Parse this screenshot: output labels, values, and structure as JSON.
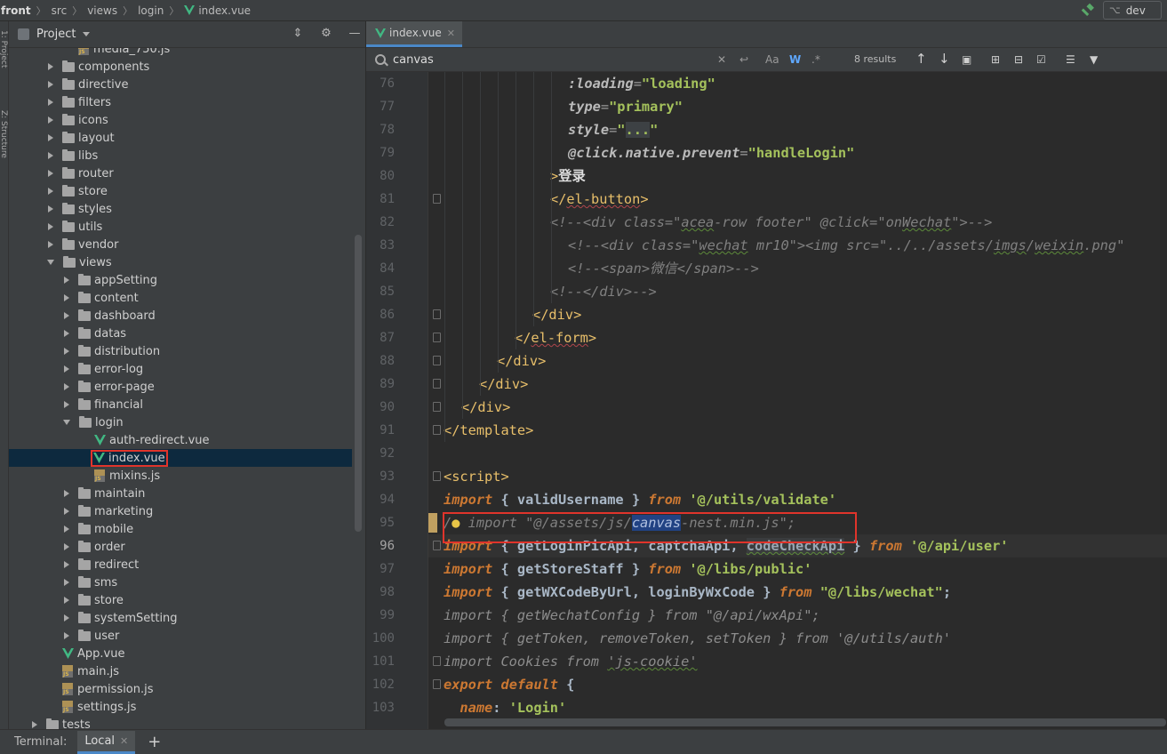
{
  "breadcrumb": [
    "front",
    "src",
    "views",
    "login",
    "index.vue"
  ],
  "branch": "dev",
  "project_panel": {
    "title": "Project",
    "tree": [
      {
        "label": "media_750.js",
        "type": "js",
        "depth": 3,
        "state": "none"
      },
      {
        "label": "components",
        "type": "folder",
        "depth": 2,
        "state": "collapsed"
      },
      {
        "label": "directive",
        "type": "folder",
        "depth": 2,
        "state": "collapsed"
      },
      {
        "label": "filters",
        "type": "folder",
        "depth": 2,
        "state": "collapsed"
      },
      {
        "label": "icons",
        "type": "folder",
        "depth": 2,
        "state": "collapsed"
      },
      {
        "label": "layout",
        "type": "folder",
        "depth": 2,
        "state": "collapsed"
      },
      {
        "label": "libs",
        "type": "folder",
        "depth": 2,
        "state": "collapsed"
      },
      {
        "label": "router",
        "type": "folder",
        "depth": 2,
        "state": "collapsed"
      },
      {
        "label": "store",
        "type": "folder",
        "depth": 2,
        "state": "collapsed"
      },
      {
        "label": "styles",
        "type": "folder",
        "depth": 2,
        "state": "collapsed"
      },
      {
        "label": "utils",
        "type": "folder",
        "depth": 2,
        "state": "collapsed"
      },
      {
        "label": "vendor",
        "type": "folder",
        "depth": 2,
        "state": "collapsed"
      },
      {
        "label": "views",
        "type": "folder",
        "depth": 2,
        "state": "expanded"
      },
      {
        "label": "appSetting",
        "type": "folder",
        "depth": 3,
        "state": "collapsed"
      },
      {
        "label": "content",
        "type": "folder",
        "depth": 3,
        "state": "collapsed"
      },
      {
        "label": "dashboard",
        "type": "folder",
        "depth": 3,
        "state": "collapsed"
      },
      {
        "label": "datas",
        "type": "folder",
        "depth": 3,
        "state": "collapsed"
      },
      {
        "label": "distribution",
        "type": "folder",
        "depth": 3,
        "state": "collapsed"
      },
      {
        "label": "error-log",
        "type": "folder",
        "depth": 3,
        "state": "collapsed"
      },
      {
        "label": "error-page",
        "type": "folder",
        "depth": 3,
        "state": "collapsed"
      },
      {
        "label": "financial",
        "type": "folder",
        "depth": 3,
        "state": "collapsed"
      },
      {
        "label": "login",
        "type": "folder",
        "depth": 3,
        "state": "expanded"
      },
      {
        "label": "auth-redirect.vue",
        "type": "vue",
        "depth": 4,
        "state": "none"
      },
      {
        "label": "index.vue",
        "type": "vue",
        "depth": 4,
        "state": "none",
        "selected": true
      },
      {
        "label": "mixins.js",
        "type": "js",
        "depth": 4,
        "state": "none"
      },
      {
        "label": "maintain",
        "type": "folder",
        "depth": 3,
        "state": "collapsed"
      },
      {
        "label": "marketing",
        "type": "folder",
        "depth": 3,
        "state": "collapsed"
      },
      {
        "label": "mobile",
        "type": "folder",
        "depth": 3,
        "state": "collapsed"
      },
      {
        "label": "order",
        "type": "folder",
        "depth": 3,
        "state": "collapsed"
      },
      {
        "label": "redirect",
        "type": "folder",
        "depth": 3,
        "state": "collapsed"
      },
      {
        "label": "sms",
        "type": "folder",
        "depth": 3,
        "state": "collapsed"
      },
      {
        "label": "store",
        "type": "folder",
        "depth": 3,
        "state": "collapsed"
      },
      {
        "label": "systemSetting",
        "type": "folder",
        "depth": 3,
        "state": "collapsed"
      },
      {
        "label": "user",
        "type": "folder",
        "depth": 3,
        "state": "collapsed"
      },
      {
        "label": "App.vue",
        "type": "vue",
        "depth": 2,
        "state": "none"
      },
      {
        "label": "main.js",
        "type": "js",
        "depth": 2,
        "state": "none"
      },
      {
        "label": "permission.js",
        "type": "js",
        "depth": 2,
        "state": "none"
      },
      {
        "label": "settings.js",
        "type": "js",
        "depth": 2,
        "state": "none"
      },
      {
        "label": "tests",
        "type": "folder",
        "depth": 1,
        "state": "collapsed"
      }
    ]
  },
  "editor": {
    "tab": "index.vue",
    "search": {
      "value": "canvas",
      "results": "8 results",
      "case_label": "Aa",
      "word_label": "W",
      "regex_label": ".*"
    },
    "current_line": 96,
    "lines": [
      {
        "n": 76,
        "fold": false
      },
      {
        "n": 77,
        "fold": false
      },
      {
        "n": 78,
        "fold": false
      },
      {
        "n": 79,
        "fold": false
      },
      {
        "n": 80,
        "fold": false
      },
      {
        "n": 81,
        "fold": true
      },
      {
        "n": 82,
        "fold": false
      },
      {
        "n": 83,
        "fold": false
      },
      {
        "n": 84,
        "fold": false
      },
      {
        "n": 85,
        "fold": false
      },
      {
        "n": 86,
        "fold": true
      },
      {
        "n": 87,
        "fold": true
      },
      {
        "n": 88,
        "fold": true
      },
      {
        "n": 89,
        "fold": true
      },
      {
        "n": 90,
        "fold": true
      },
      {
        "n": 91,
        "fold": true
      },
      {
        "n": 92,
        "fold": false
      },
      {
        "n": 93,
        "fold": true
      },
      {
        "n": 94,
        "fold": false
      },
      {
        "n": 95,
        "fold": false
      },
      {
        "n": 96,
        "fold": true
      },
      {
        "n": 97,
        "fold": false
      },
      {
        "n": 98,
        "fold": false
      },
      {
        "n": 99,
        "fold": false
      },
      {
        "n": 100,
        "fold": false
      },
      {
        "n": 101,
        "fold": true
      },
      {
        "n": 102,
        "fold": true
      },
      {
        "n": 103,
        "fold": false
      }
    ],
    "code": {
      "l76a": ":loading",
      "l76b": "=",
      "l76c": "\"loading\"",
      "l77a": "type",
      "l77b": "=",
      "l77c": "\"primary\"",
      "l78a": "style",
      "l78b": "=",
      "l78c": "\"",
      "l78d": "...",
      "l78e": "\"",
      "l79a": "@click.native.prevent",
      "l79b": "=",
      "l79c": "\"handleLogin\"",
      "l80a": ">",
      "l80b": "登录",
      "l81a": "</",
      "l81b": "el-button",
      "l81c": ">",
      "l82a": "<!--<div class=\"",
      "l82b": "acea",
      "l82c": "-row footer\" @click=\"on",
      "l82d": "Wechat",
      "l82e": "\">-->",
      "l83a": "<!--<div class=\"",
      "l83b": "wechat",
      "l83c": " mr10\"><img src=\"../../assets/",
      "l83d": "imgs",
      "l83e": "/",
      "l83f": "weixin",
      "l83g": ".png\"",
      "l84": "<!--<span>微信</span>-->",
      "l85": "<!--</div>-->",
      "l86a": "</",
      "l86b": "div",
      "l86c": ">",
      "l87a": "</",
      "l87b": "el-form",
      "l87c": ">",
      "l88a": "</",
      "l88b": "div",
      "l88c": ">",
      "l89a": "</",
      "l89b": "div",
      "l89c": ">",
      "l90a": "</",
      "l90b": "div",
      "l90c": ">",
      "l91a": "</",
      "l91b": "template",
      "l91c": ">",
      "l93a": "<",
      "l93b": "script",
      "l93c": ">",
      "l94a": "import",
      "l94b": " { ",
      "l94c": "validUsername",
      "l94d": " } ",
      "l94e": "from",
      "l94f": " '@/utils/validate'",
      "l95a": "/",
      "l95b": " import \"@/assets/js/",
      "l95c": "canvas",
      "l95d": "-nest.min.js\";",
      "l96a": "import",
      "l96b": " { ",
      "l96c": "getLoginPicApi",
      "l96d": ", ",
      "l96e": "captchaApi",
      "l96f": ", ",
      "l96g": "codeCheckApi",
      "l96h": " } ",
      "l96i": "from",
      "l96j": " '@/api/user'",
      "l97a": "import",
      "l97b": " { ",
      "l97c": "getStoreStaff",
      "l97d": " } ",
      "l97e": "from",
      "l97f": " '@/libs/public'",
      "l98a": "import",
      "l98b": " { ",
      "l98c": "getWXCodeByUrl",
      "l98d": ", ",
      "l98e": "loginByWxCode",
      "l98f": " } ",
      "l98g": "from",
      "l98h": " \"@/libs/wechat\"",
      "l98i": ";",
      "l99": "import { getWechatConfig } from \"@/api/wxApi\";",
      "l100": "import { getToken, removeToken, setToken } from '@/utils/auth'",
      "l101a": "import Cookies ",
      "l101b": "from",
      "l101c": " ",
      "l101d": "'js-cookie'",
      "l102a": "export",
      "l102b": " ",
      "l102c": "default",
      "l102d": " {",
      "l103a": "  name",
      "l103b": ": ",
      "l103c": "'Login'"
    }
  },
  "bottom": {
    "terminal_label": "Terminal:",
    "local_tab": "Local",
    "plus": "+"
  },
  "colors": {
    "highlight_box": "#e0342b",
    "accent": "#4a88c7"
  }
}
